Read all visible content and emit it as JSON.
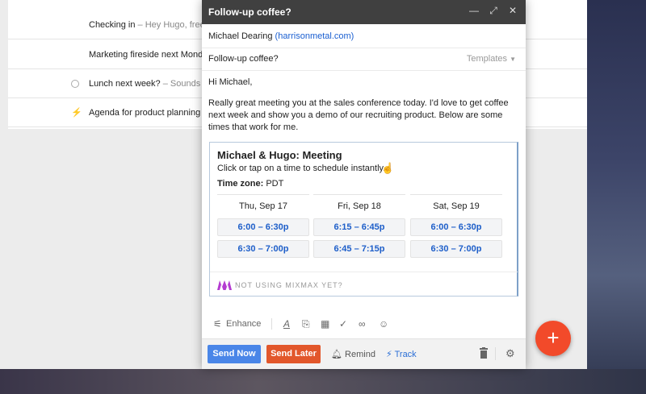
{
  "inbox": {
    "rows": [
      {
        "subject": "Checking in",
        "snippet": " – Hey Hugo, free"
      },
      {
        "subject": "Marketing fireside next Monda",
        "snippet": ""
      },
      {
        "subject": "Lunch next week?",
        "snippet": " – Sounds g"
      },
      {
        "subject": "Agenda for product planning r",
        "snippet": ""
      }
    ]
  },
  "compose": {
    "title": "Follow-up coffee?",
    "to_name": "Michael Dearing",
    "to_domain": "(harrisonmetal.com)",
    "subject": "Follow-up coffee?",
    "templates_label": "Templates",
    "greeting": "Hi Michael,",
    "body": "Really great meeting you at the sales conference today. I'd love to get coffee next week and show you a demo of our recruiting product. Below are some times that work for me."
  },
  "card": {
    "title": "Michael & Hugo: Meeting",
    "subtitle": "Click or tap on a time to schedule instantly.",
    "tz_label": "Time zone:",
    "tz_value": "PDT",
    "days": [
      {
        "label": "Thu, Sep 17",
        "slots": [
          "6:00 – 6:30p",
          "6:30 – 7:00p"
        ]
      },
      {
        "label": "Fri, Sep 18",
        "slots": [
          "6:15 – 6:45p",
          "6:45 – 7:15p"
        ]
      },
      {
        "label": "Sat, Sep 19",
        "slots": [
          "6:00 – 6:30p",
          "6:30 – 7:00p"
        ]
      }
    ],
    "footer": "NOT USING MIXMAX YET?"
  },
  "toolbar": {
    "enhance_label": "Enhance"
  },
  "actions": {
    "send_now": "Send Now",
    "send_later": "Send Later",
    "remind": "Remind",
    "track": "Track"
  },
  "colors": {
    "send_now": "#4a86e8",
    "send_later": "#e2572b",
    "fab": "#f24a2a",
    "link": "#1a5fd1"
  }
}
